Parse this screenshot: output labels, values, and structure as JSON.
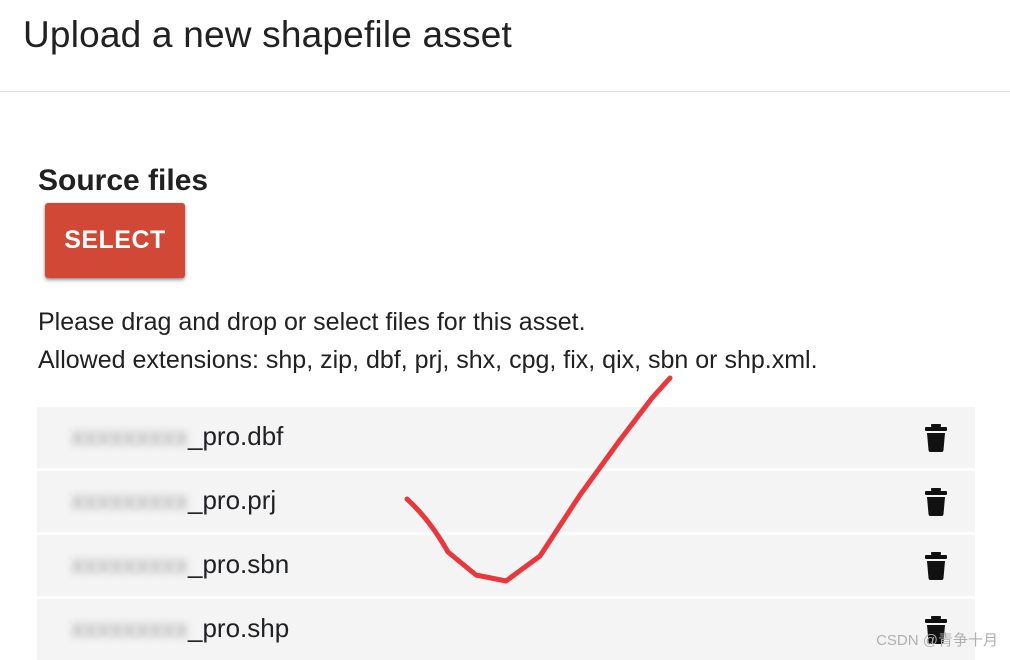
{
  "dialog": {
    "title": "Upload a new shapefile asset"
  },
  "source_files": {
    "heading": "Source files",
    "select_label": "SELECT",
    "help_line1": "Please drag and drop or select files for this asset.",
    "help_line2": "Allowed extensions: shp, zip, dbf, prj, shx, cpg, fix, qix, sbn or shp.xml."
  },
  "files": [
    {
      "name_prefix": "xxxxxxxxx",
      "name_suffix": "_pro.dbf",
      "delete_icon": "trash-icon"
    },
    {
      "name_prefix": "xxxxxxxxx",
      "name_suffix": "_pro.prj",
      "delete_icon": "trash-icon"
    },
    {
      "name_prefix": "xxxxxxxxx",
      "name_suffix": "_pro.sbn",
      "delete_icon": "trash-icon"
    },
    {
      "name_prefix": "xxxxxxxxx",
      "name_suffix": "_pro.shp",
      "delete_icon": "trash-icon"
    }
  ],
  "colors": {
    "select_button": "#d14836",
    "row_background": "#f4f4f4",
    "checkmark": "#e8383d"
  },
  "watermark": "CSDN @青争十月"
}
